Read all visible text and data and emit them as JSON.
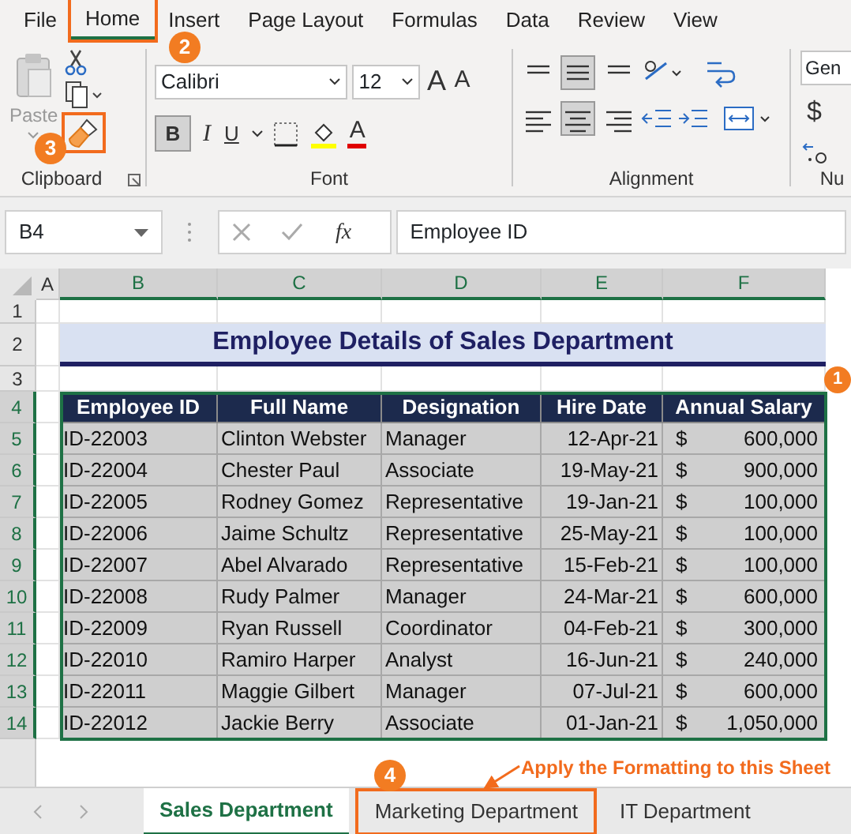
{
  "ribbon_tabs": [
    {
      "label": "File",
      "selected": false
    },
    {
      "label": "Home",
      "selected": true,
      "highlighted": true
    },
    {
      "label": "Insert",
      "selected": false
    },
    {
      "label": "Page Layout",
      "selected": false
    },
    {
      "label": "Formulas",
      "selected": false
    },
    {
      "label": "Data",
      "selected": false
    },
    {
      "label": "Review",
      "selected": false
    },
    {
      "label": "View",
      "selected": false
    }
  ],
  "clipboard": {
    "paste": "Paste",
    "label": "Clipboard",
    "format_painter_highlighted": true
  },
  "font": {
    "name": "Calibri",
    "size": "12",
    "grow": "A",
    "shrink": "A",
    "bold": "B",
    "bold_on": true,
    "italic": "I",
    "underline": "U",
    "color_letter": "A",
    "label": "Font"
  },
  "alignment": {
    "label": "Alignment"
  },
  "number": {
    "format": "Gen",
    "currency": "$",
    "label": "Nu"
  },
  "name_box": "B4",
  "fx": "fx",
  "formula": "Employee ID",
  "column_headers": [
    {
      "label": "A",
      "selected": false
    },
    {
      "label": "B",
      "selected": true
    },
    {
      "label": "C",
      "selected": true
    },
    {
      "label": "D",
      "selected": true
    },
    {
      "label": "E",
      "selected": true
    },
    {
      "label": "F",
      "selected": true
    }
  ],
  "row_headers": [
    {
      "label": "1",
      "selected": false
    },
    {
      "label": "2",
      "selected": false
    },
    {
      "label": "3",
      "selected": false
    },
    {
      "label": "4",
      "selected": true
    },
    {
      "label": "5",
      "selected": true
    },
    {
      "label": "6",
      "selected": true
    },
    {
      "label": "7",
      "selected": true
    },
    {
      "label": "8",
      "selected": true
    },
    {
      "label": "9",
      "selected": true
    },
    {
      "label": "10",
      "selected": true
    },
    {
      "label": "11",
      "selected": true
    },
    {
      "label": "12",
      "selected": true
    },
    {
      "label": "13",
      "selected": true
    },
    {
      "label": "14",
      "selected": true
    }
  ],
  "title": "Employee Details of Sales Department",
  "table": {
    "columns": [
      "Employee ID",
      "Full Name",
      "Designation",
      "Hire Date",
      "Annual Salary"
    ],
    "rows": [
      {
        "id": "ID-22003",
        "name": "Clinton Webster",
        "designation": "Manager",
        "hire_date": "12-Apr-21",
        "currency": "$",
        "salary": "600,000"
      },
      {
        "id": "ID-22004",
        "name": "Chester Paul",
        "designation": "Associate",
        "hire_date": "19-May-21",
        "currency": "$",
        "salary": "900,000"
      },
      {
        "id": "ID-22005",
        "name": "Rodney Gomez",
        "designation": "Representative",
        "hire_date": "19-Jan-21",
        "currency": "$",
        "salary": "100,000"
      },
      {
        "id": "ID-22006",
        "name": "Jaime Schultz",
        "designation": "Representative",
        "hire_date": "25-May-21",
        "currency": "$",
        "salary": "100,000"
      },
      {
        "id": "ID-22007",
        "name": "Abel Alvarado",
        "designation": "Representative",
        "hire_date": "15-Feb-21",
        "currency": "$",
        "salary": "100,000"
      },
      {
        "id": "ID-22008",
        "name": "Rudy Palmer",
        "designation": "Manager",
        "hire_date": "24-Mar-21",
        "currency": "$",
        "salary": "600,000"
      },
      {
        "id": "ID-22009",
        "name": "Ryan Russell",
        "designation": "Coordinator",
        "hire_date": "04-Feb-21",
        "currency": "$",
        "salary": "300,000"
      },
      {
        "id": "ID-22010",
        "name": "Ramiro Harper",
        "designation": "Analyst",
        "hire_date": "16-Jun-21",
        "currency": "$",
        "salary": "240,000"
      },
      {
        "id": "ID-22011",
        "name": "Maggie Gilbert",
        "designation": "Manager",
        "hire_date": "07-Jul-21",
        "currency": "$",
        "salary": "600,000"
      },
      {
        "id": "ID-22012",
        "name": "Jackie Berry",
        "designation": "Associate",
        "hire_date": "01-Jan-21",
        "currency": "$",
        "salary": "1,050,000"
      }
    ]
  },
  "sheet_tabs": [
    {
      "label": "Sales Department",
      "selected": true,
      "highlighted": false
    },
    {
      "label": "Marketing Department",
      "selected": false,
      "highlighted": true
    },
    {
      "label": "IT Department",
      "selected": false,
      "highlighted": false
    }
  ],
  "callouts": [
    "1",
    "2",
    "3",
    "4"
  ],
  "note": "Apply the Formatting to this Sheet"
}
